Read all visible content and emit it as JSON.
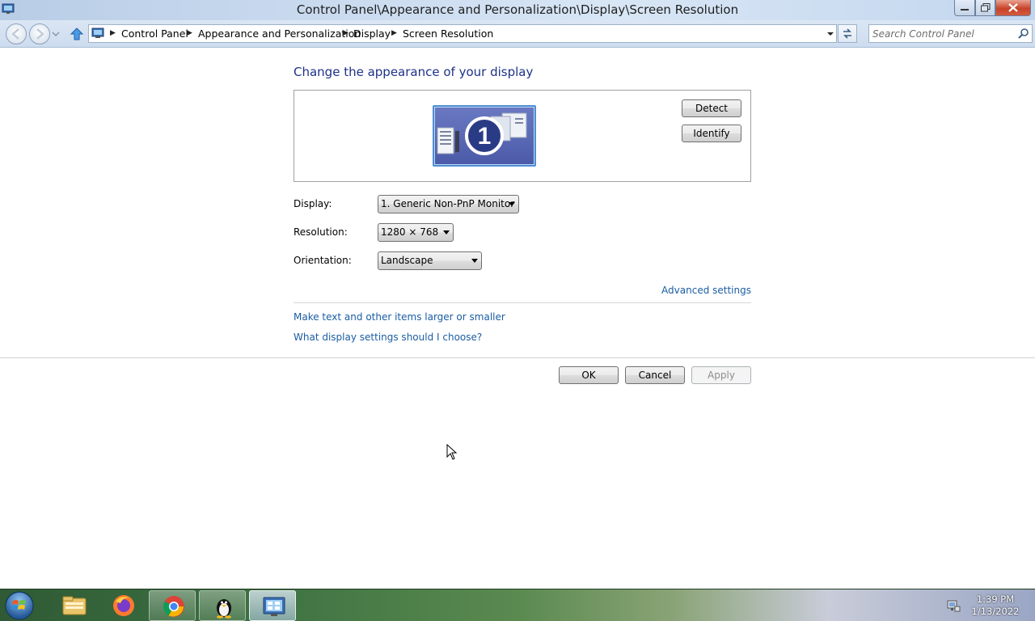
{
  "window": {
    "title": "Control Panel\\Appearance and Personalization\\Display\\Screen Resolution"
  },
  "navigation": {
    "breadcrumbs": [
      "Control Panel",
      "Appearance and Personalization",
      "Display",
      "Screen Resolution"
    ],
    "search_placeholder": "Search Control Panel"
  },
  "page": {
    "heading": "Change the appearance of your display",
    "monitor_number": "1",
    "detect_label": "Detect",
    "identify_label": "Identify",
    "display_label": "Display:",
    "display_value": "1. Generic Non-PnP Monitor",
    "resolution_label": "Resolution:",
    "resolution_value": "1280 × 768",
    "orientation_label": "Orientation:",
    "orientation_value": "Landscape",
    "advanced_link": "Advanced settings",
    "larger_link": "Make text and other items larger or smaller",
    "choose_link": "What display settings should I choose?",
    "ok_label": "OK",
    "cancel_label": "Cancel",
    "apply_label": "Apply"
  },
  "taskbar": {
    "items": [
      "start-orb-icon",
      "file-explorer-icon",
      "firefox-icon",
      "chrome-icon",
      "linux-tux-icon",
      "control-panel-icon"
    ],
    "time": "1:39 PM",
    "date": "1/13/2022"
  },
  "colors": {
    "heading": "#1e3287",
    "link": "#1a5da3",
    "monitor_fill": "#4b5aa8",
    "monitor_border": "#4f8fd0"
  }
}
